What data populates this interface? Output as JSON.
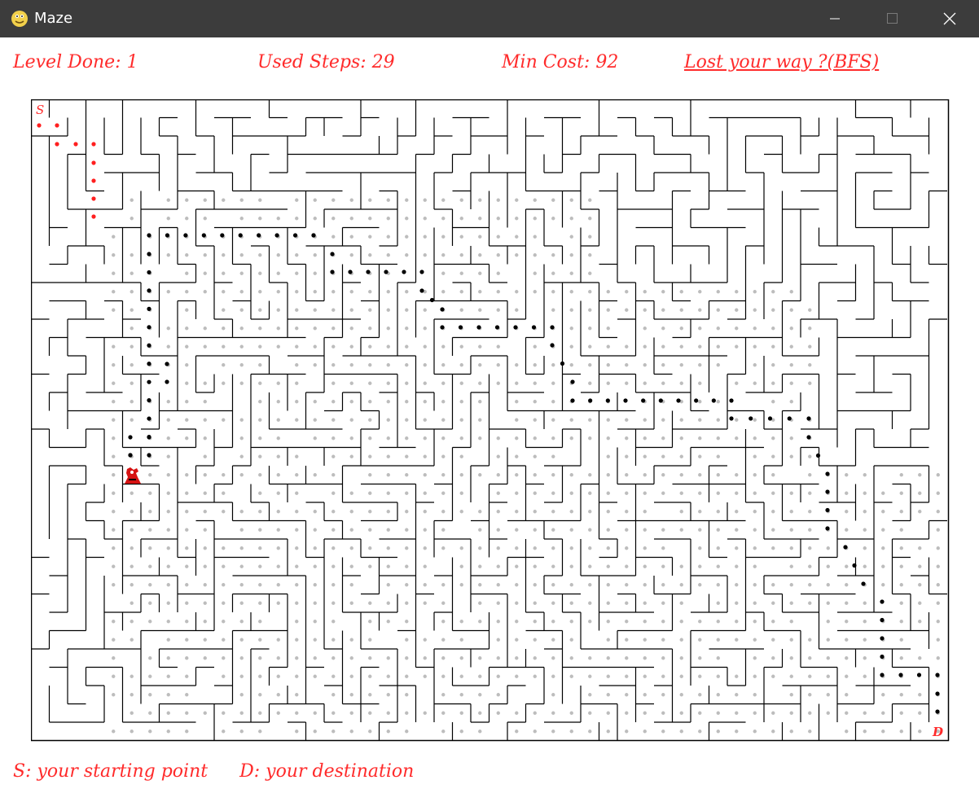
{
  "window": {
    "title": "Maze",
    "app_icon": "python-snake-icon"
  },
  "controls": {
    "minimize_icon": "minimize-icon",
    "maximize_icon": "maximize-icon",
    "close_icon": "close-icon"
  },
  "hud": {
    "level_done": "Level Done: 1",
    "used_steps": "Used Steps: 29",
    "min_cost": "Min Cost: 92",
    "hint_link": "Lost your way ?(BFS)"
  },
  "legend": {
    "start": "S: your starting point",
    "destination": "D: your destination"
  },
  "maze": {
    "start_label": "S",
    "destination_label": "D",
    "colors": {
      "wall": "#000000",
      "trail": "#ff1f1f",
      "bfs_path": "#000000",
      "explored": "#bdbdbd",
      "label": "#ff2b2b",
      "player": "#d61212"
    }
  }
}
